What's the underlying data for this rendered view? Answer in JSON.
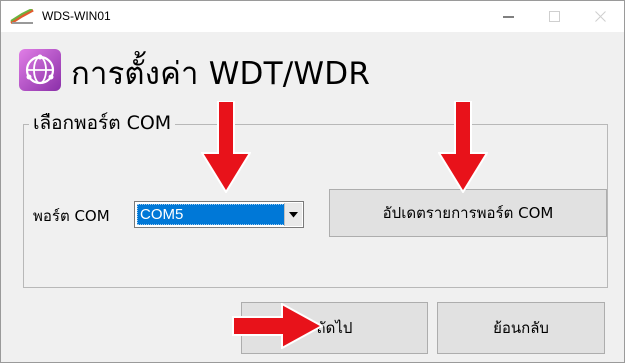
{
  "window": {
    "title": "WDS-WIN01",
    "icons": {
      "app": "app-logo-icon",
      "minimize": "minimize-icon",
      "maximize": "maximize-icon",
      "close": "close-icon"
    }
  },
  "header": {
    "title": "การตั้งค่า WDT/WDR",
    "icon": "network-globe-icon"
  },
  "com_group": {
    "legend": "เลือกพอร์ต COM",
    "port_label": "พอร์ต COM",
    "port_value": "COM5",
    "update_button": "อัปเดตรายการพอร์ต COM"
  },
  "footer": {
    "next_button": "ถัดไป",
    "back_button": "ย้อนกลับ"
  },
  "annotations": {
    "arrow_color": "#e8121a",
    "arrows": [
      "arrow-down-icon",
      "arrow-down-icon",
      "arrow-right-icon"
    ]
  },
  "colors": {
    "selection": "#0078d7",
    "window_bg": "#f0f0f0",
    "button_bg": "#e1e1e1"
  }
}
